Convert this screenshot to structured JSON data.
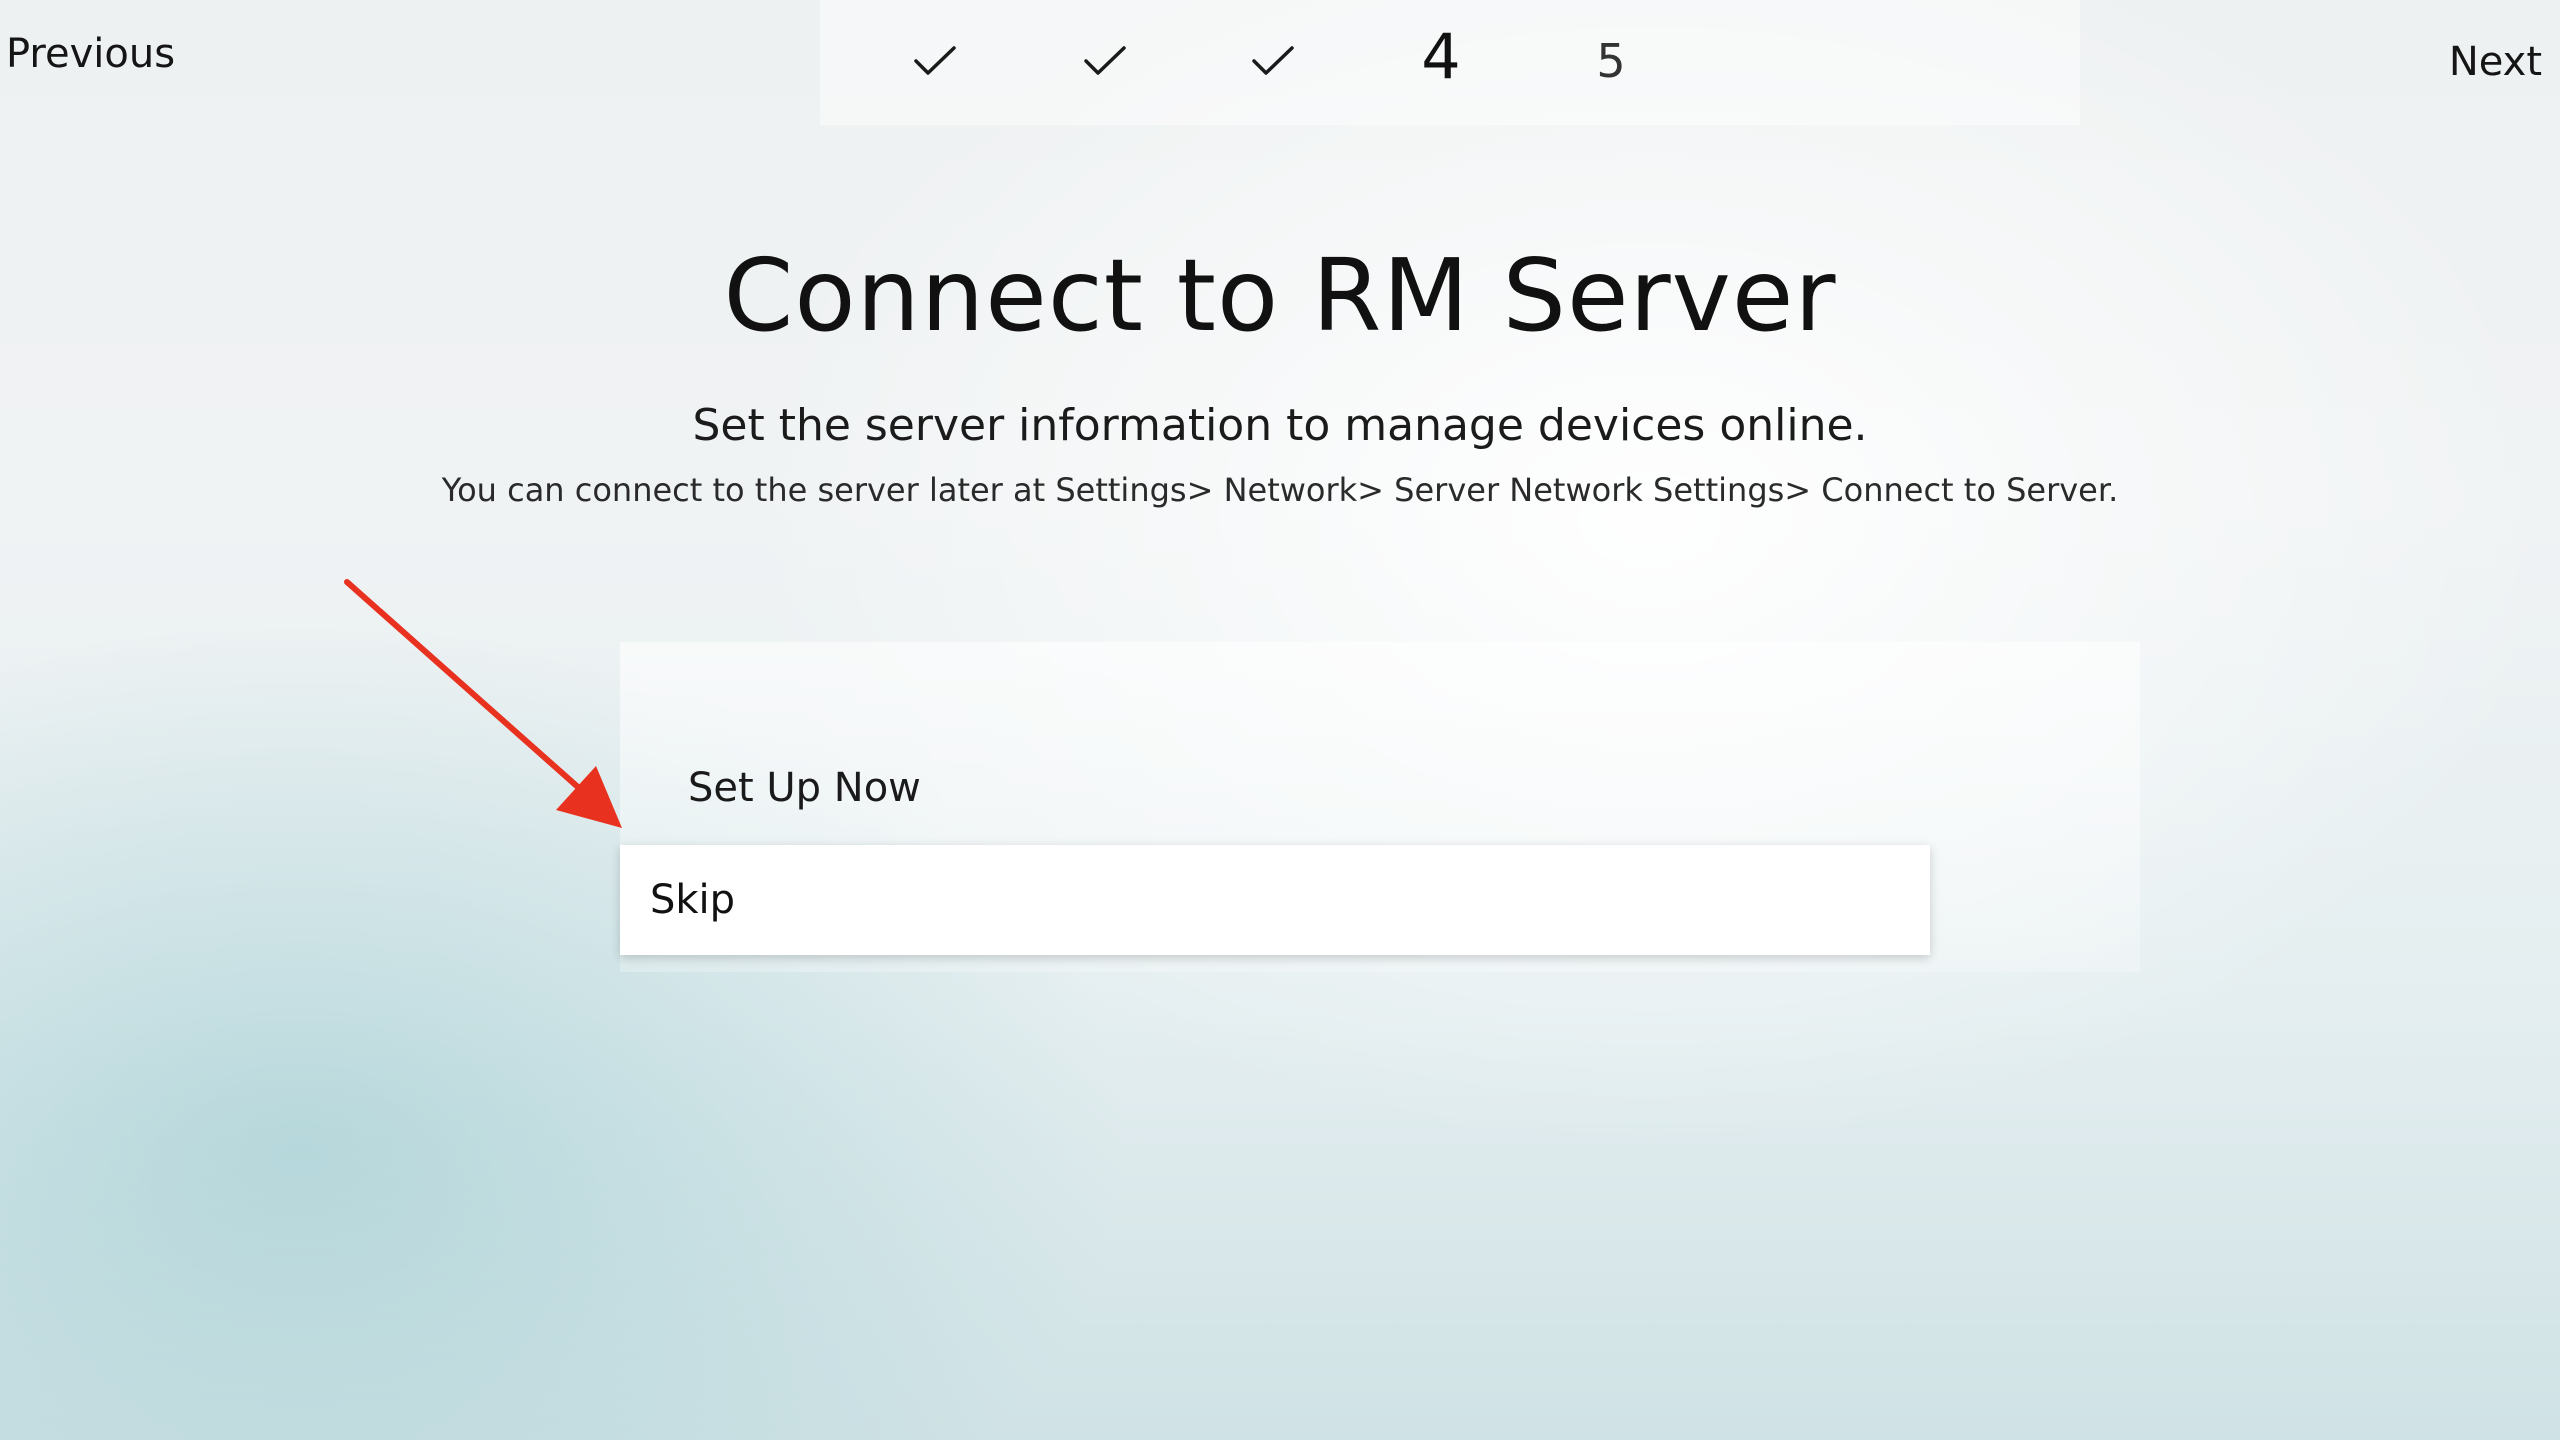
{
  "nav": {
    "previous_label": "Previous",
    "next_label": "Next"
  },
  "steps": [
    {
      "label": "",
      "state": "completed",
      "icon": "check-icon"
    },
    {
      "label": "",
      "state": "completed",
      "icon": "check-icon"
    },
    {
      "label": "",
      "state": "completed",
      "icon": "check-icon"
    },
    {
      "label": "4",
      "state": "current"
    },
    {
      "label": "5",
      "state": "upcoming"
    }
  ],
  "main": {
    "title": "Connect to RM Server",
    "subtitle": "Set the server information to manage devices online.",
    "hint": "You can connect to the server later at Settings> Network> Server Network Settings> Connect to Server."
  },
  "options": [
    {
      "label": "Set Up Now",
      "focused": false
    },
    {
      "label": "Skip",
      "focused": true
    }
  ],
  "annotation": {
    "type": "arrow",
    "color": "#e8321f",
    "points_to": "Skip"
  }
}
